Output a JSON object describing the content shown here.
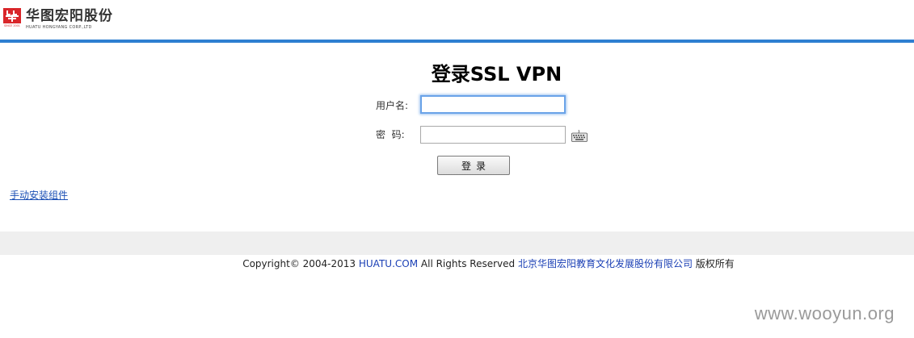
{
  "header": {
    "logo_cn": "华图宏阳股份",
    "logo_en": "HUATU HONGYANG CORP.,LTD",
    "logo_mark_text": "SINCE 2001",
    "brand_color": "#d9262a",
    "accent_bar_color": "#2e7fd1"
  },
  "login": {
    "title": "登录SSL VPN",
    "username_label": "用户名:",
    "username_value": "",
    "password_label": "密  码:",
    "password_value": "",
    "keyboard_icon": "keyboard-icon",
    "submit_label": "登录"
  },
  "links": {
    "install_components": "手动安装组件"
  },
  "footer": {
    "copyright_prefix": "Copyright© 2004-2013",
    "site_link": "HUATU.COM",
    "rights": "All Rights Reserved",
    "company_link": "北京华图宏阳教育文化发展股份有限公司",
    "suffix": "版权所有"
  },
  "watermark": "www.wooyun.org"
}
